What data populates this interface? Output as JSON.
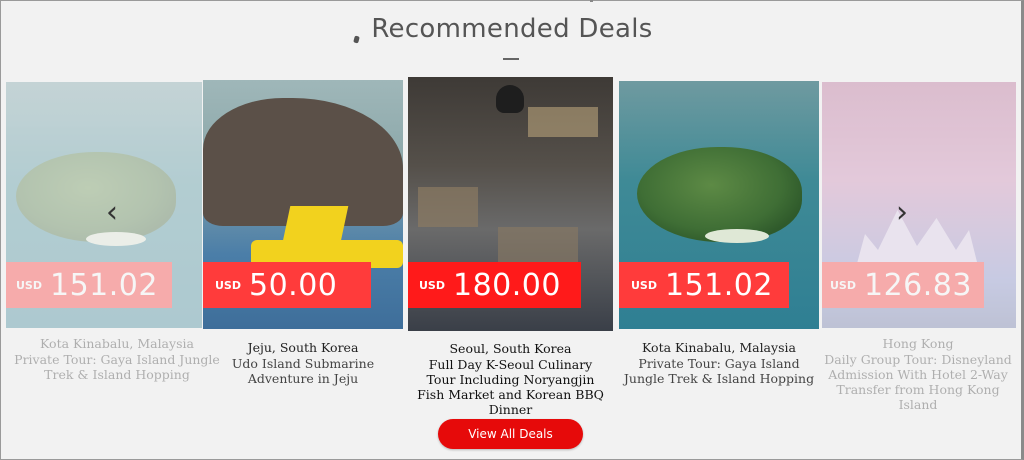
{
  "section": {
    "title": "Recommended Deals"
  },
  "deals": [
    {
      "currency": "USD",
      "price": "151.02",
      "city": "Kota Kinabalu, Malaysia",
      "description": "Private Tour: Gaya Island Jungle Trek & Island Hopping"
    },
    {
      "currency": "USD",
      "price": "50.00",
      "city": "Jeju, South Korea",
      "description": "Udo Island Submarine Adventure in Jeju"
    },
    {
      "currency": "USD",
      "price": "180.00",
      "city": "Seoul, South Korea",
      "description": "Full Day K-Seoul Culinary Tour Including Noryangjin Fish Market and Korean BBQ Dinner"
    },
    {
      "currency": "USD",
      "price": "151.02",
      "city": "Kota Kinabalu, Malaysia",
      "description": "Private Tour: Gaya Island Jungle Trek & Island Hopping"
    },
    {
      "currency": "USD",
      "price": "126.83",
      "city": "Hong Kong",
      "description": "Daily Group Tour: Disneyland Admission With Hotel 2-Way Transfer from Hong Kong Island"
    }
  ],
  "carousel": {
    "prev_icon": "chevron-left-icon",
    "next_icon": "chevron-right-icon"
  },
  "cta": {
    "label": "View All Deals"
  },
  "colors": {
    "accent": "#e60a0a",
    "price_badge": "#ff2a2a",
    "price_badge_faded": "#f27a7a"
  }
}
